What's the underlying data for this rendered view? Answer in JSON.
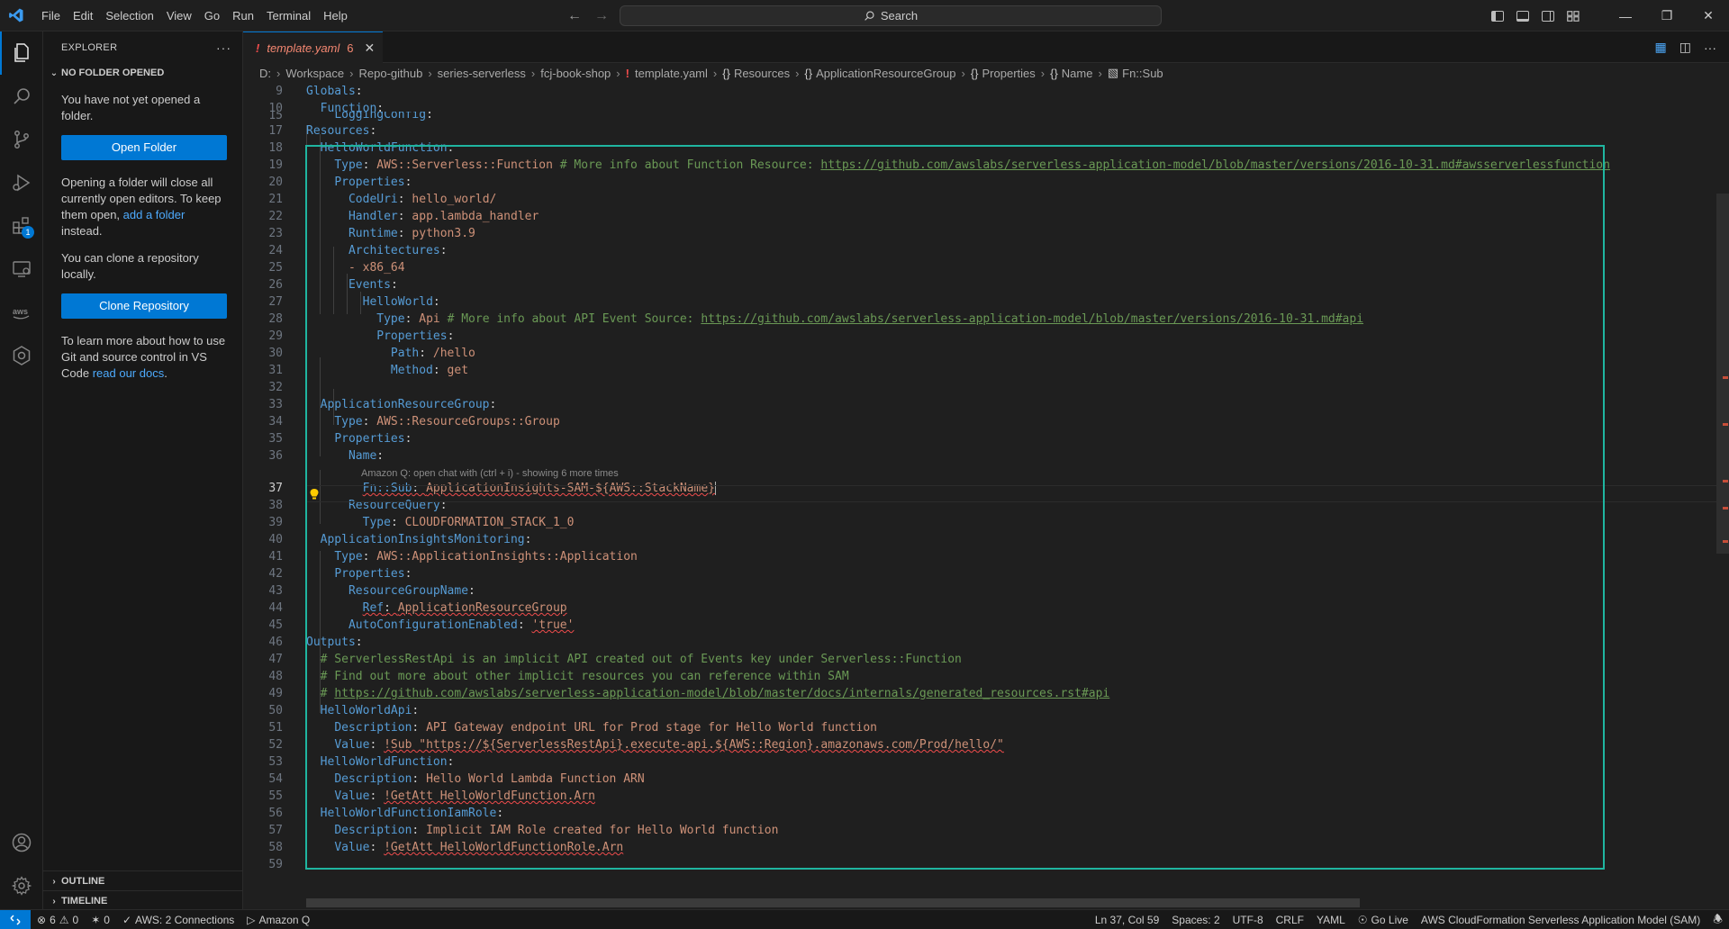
{
  "menu": [
    "File",
    "Edit",
    "Selection",
    "View",
    "Go",
    "Run",
    "Terminal",
    "Help"
  ],
  "search": {
    "label": "Search"
  },
  "sidebar": {
    "title": "EXPLORER",
    "section": "NO FOLDER OPENED",
    "msg1": "You have not yet opened a folder.",
    "open_folder": "Open Folder",
    "msg2_a": "Opening a folder will close all currently open editors. To keep them open, ",
    "msg2_link": "add a folder",
    "msg2_b": " instead.",
    "msg3": "You can clone a repository locally.",
    "clone": "Clone Repository",
    "msg4_a": "To learn more about how to use Git and source control in VS Code ",
    "msg4_link": "read our docs",
    "msg4_b": ".",
    "outline": "OUTLINE",
    "timeline": "TIMELINE",
    "extensions_badge": "1"
  },
  "tab": {
    "excl": "!",
    "name": "template.yaml",
    "count": "6"
  },
  "breadcrumb": {
    "drive": "D:",
    "items": [
      "Workspace",
      "Repo-github",
      "series-serverless",
      "fcj-book-shop"
    ],
    "file": "template.yaml",
    "symbols": [
      "Resources",
      "ApplicationResourceGroup",
      "Properties",
      "Name"
    ],
    "last": "Fn::Sub"
  },
  "code": {
    "l9": [
      "9",
      "Globals"
    ],
    "l10": [
      "10",
      "Function"
    ],
    "l15": [
      "15",
      "LoggingConfig"
    ],
    "l17": [
      "17",
      "Resources"
    ],
    "l18": [
      "18",
      "HelloWorldFunction"
    ],
    "l19": [
      "19",
      "Type",
      "AWS::Serverless::Function",
      "# More info about Function Resource: ",
      "https://github.com/awslabs/serverless-application-model/blob/master/versions/2016-10-31.md#awsserverlessfunction"
    ],
    "l20": [
      "20",
      "Properties"
    ],
    "l21": [
      "21",
      "CodeUri",
      "hello_world/"
    ],
    "l22": [
      "22",
      "Handler",
      "app.lambda_handler"
    ],
    "l23": [
      "23",
      "Runtime",
      "python3.9"
    ],
    "l24": [
      "24",
      "Architectures"
    ],
    "l25": [
      "25",
      "- x86_64"
    ],
    "l26": [
      "26",
      "Events"
    ],
    "l27": [
      "27",
      "HelloWorld"
    ],
    "l28": [
      "28",
      "Type",
      "Api",
      "# More info about API Event Source: ",
      "https://github.com/awslabs/serverless-application-model/blob/master/versions/2016-10-31.md#api"
    ],
    "l29": [
      "29",
      "Properties"
    ],
    "l30": [
      "30",
      "Path",
      "/hello"
    ],
    "l31": [
      "31",
      "Method",
      "get"
    ],
    "l32": [
      "32"
    ],
    "l33": [
      "33",
      "ApplicationResourceGroup"
    ],
    "l34": [
      "34",
      "Type",
      "AWS::ResourceGroups::Group"
    ],
    "l35": [
      "35",
      "Properties"
    ],
    "l36": [
      "36",
      "Name"
    ],
    "hint": "Amazon Q: open chat with (ctrl + i) - showing 6 more times",
    "l37": [
      "37",
      "Fn::Sub",
      "ApplicationInsights-SAM-${AWS::StackName}"
    ],
    "l38": [
      "38",
      "ResourceQuery"
    ],
    "l39": [
      "39",
      "Type",
      "CLOUDFORMATION_STACK_1_0"
    ],
    "l40": [
      "40",
      "ApplicationInsightsMonitoring"
    ],
    "l41": [
      "41",
      "Type",
      "AWS::ApplicationInsights::Application"
    ],
    "l42": [
      "42",
      "Properties"
    ],
    "l43": [
      "43",
      "ResourceGroupName"
    ],
    "l44": [
      "44",
      "Ref",
      "ApplicationResourceGroup"
    ],
    "l45": [
      "45",
      "AutoConfigurationEnabled",
      "'true'"
    ],
    "l46": [
      "46",
      "Outputs"
    ],
    "l47": [
      "47",
      "# ServerlessRestApi is an implicit API created out of Events key under Serverless::Function"
    ],
    "l48": [
      "48",
      "# Find out more about other implicit resources you can reference within SAM"
    ],
    "l49": [
      "49",
      "# ",
      "https://github.com/awslabs/serverless-application-model/blob/master/docs/internals/generated_resources.rst#api"
    ],
    "l50": [
      "50",
      "HelloWorldApi"
    ],
    "l51": [
      "51",
      "Description",
      "API Gateway endpoint URL for Prod stage for Hello World function"
    ],
    "l52": [
      "52",
      "Value",
      "!Sub \"https://${ServerlessRestApi}.execute-api.${AWS::Region}.amazonaws.com/Prod/hello/\""
    ],
    "l53": [
      "53",
      "HelloWorldFunction"
    ],
    "l54": [
      "54",
      "Description",
      "Hello World Lambda Function ARN"
    ],
    "l55": [
      "55",
      "Value",
      "!GetAtt HelloWorldFunction.Arn"
    ],
    "l56": [
      "56",
      "HelloWorldFunctionIamRole"
    ],
    "l57": [
      "57",
      "Description",
      "Implicit IAM Role created for Hello World function"
    ],
    "l58": [
      "58",
      "Value",
      "!GetAtt HelloWorldFunctionRole.Arn"
    ],
    "l59": [
      "59"
    ]
  },
  "status": {
    "errors": "6",
    "warnings": "0",
    "ports": "0",
    "aws": "AWS: 2 Connections",
    "amazonq": "Amazon Q",
    "position": "Ln 37, Col 59",
    "spaces": "Spaces: 2",
    "encoding": "UTF-8",
    "eol": "CRLF",
    "language": "YAML",
    "golive": "Go Live",
    "sam": "AWS CloudFormation Serverless Application Model (SAM)"
  },
  "colors": {
    "accent": "#0078d4",
    "highlight": "#1fb5a0",
    "error": "#f14c4c"
  }
}
